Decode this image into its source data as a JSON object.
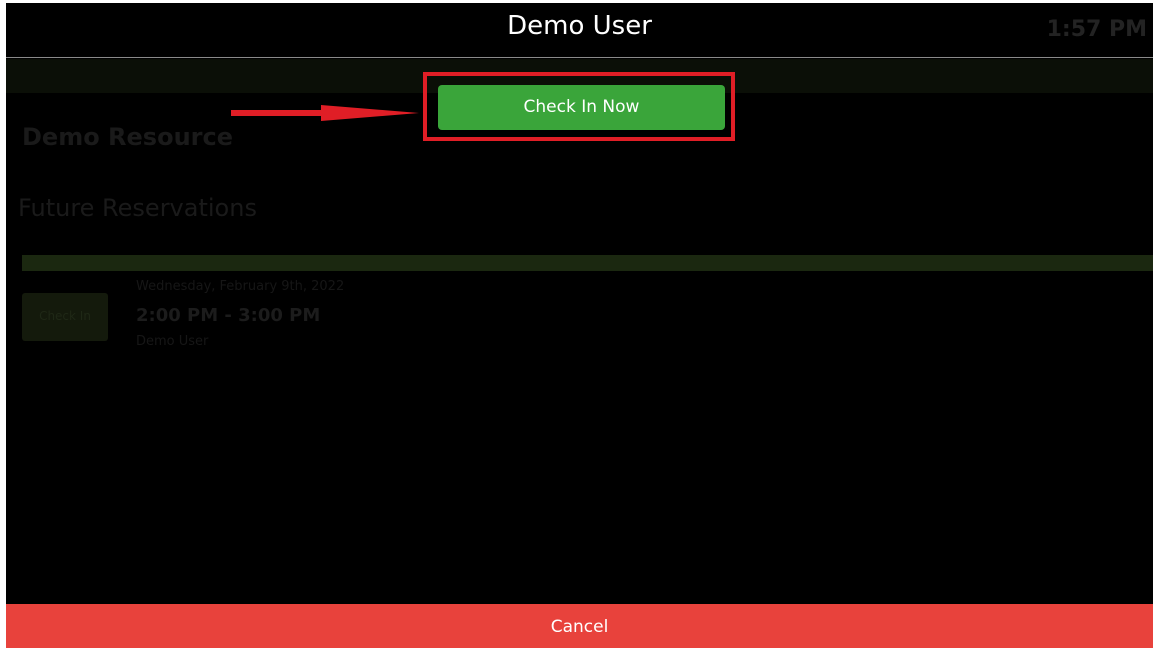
{
  "header": {
    "title": "Demo User",
    "time": "1:57 PM"
  },
  "background": {
    "resource_name": "Demo Resource",
    "section_title": "Future Reservations",
    "reservation": {
      "thumb_label": "Check In",
      "date": "Wednesday, February 9th, 2022",
      "time_range": "2:00 PM - 3:00 PM",
      "user": "Demo User"
    }
  },
  "modal": {
    "checkin_label": "Check In Now",
    "cancel_label": "Cancel"
  },
  "colors": {
    "checkin": "#3aa53a",
    "cancel": "#e8423c",
    "highlight": "#e01e26",
    "background": "#000000"
  },
  "icons": {
    "annotation_arrow": "right-arrow-icon"
  }
}
